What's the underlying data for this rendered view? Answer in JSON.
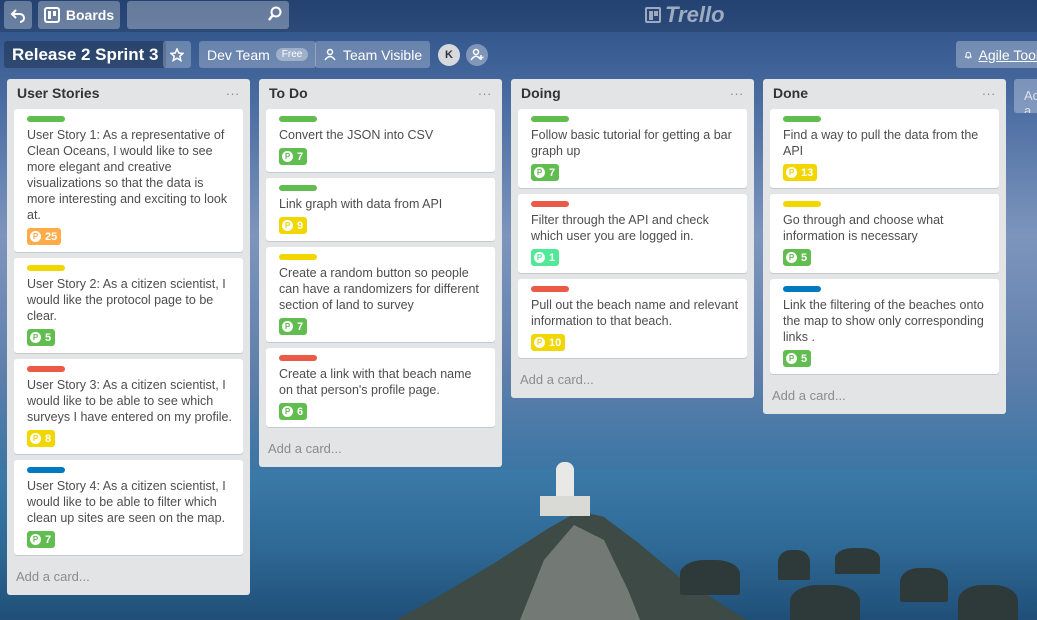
{
  "header": {
    "boards_label": "Boards",
    "search_placeholder": "",
    "logo_text": "Trello"
  },
  "board": {
    "title": "Release 2 Sprint 3",
    "team_label": "Dev Team",
    "team_badge": "Free",
    "visibility_label": "Team Visible",
    "avatar_initial": "K",
    "agile_label": "Agile Tools"
  },
  "colors": {
    "green": "#61bd4f",
    "yellow": "#f2d600",
    "red": "#eb5a46",
    "blue": "#0079bf",
    "orange": "#ffab4a",
    "teal": "#51e898"
  },
  "lists": [
    {
      "title": "User Stories",
      "menu": "...",
      "add_card": "Add a card...",
      "cards": [
        {
          "label": "green",
          "text": "User Story 1: As a representative of Clean Oceans, I would like to see more elegant and creative visualizations so that the data is more interesting and exciting to look at.",
          "points": "25",
          "badge": "orange"
        },
        {
          "label": "yellow",
          "text": "User Story 2: As a citizen scientist, I would like the protocol page to be clear.",
          "points": "5",
          "badge": "green"
        },
        {
          "label": "red",
          "text": "User Story 3: As a citizen scientist, I would like to be able to see which surveys I have entered on my profile.",
          "points": "8",
          "badge": "yellow"
        },
        {
          "label": "blue",
          "text": "User Story 4: As a citizen scientist, I would like to be able to filter which clean up sites are seen on the map.",
          "points": "7",
          "badge": "green"
        }
      ]
    },
    {
      "title": "To Do",
      "menu": "...",
      "add_card": "Add a card...",
      "cards": [
        {
          "label": "green",
          "text": "Convert the JSON into CSV",
          "points": "7",
          "badge": "green"
        },
        {
          "label": "green",
          "text": "Link graph with data from API",
          "points": "9",
          "badge": "yellow"
        },
        {
          "label": "yellow",
          "text": "Create a random button so people can have a randomizers for different section of land to survey",
          "points": "7",
          "badge": "green"
        },
        {
          "label": "red",
          "text": "Create a link with that beach name on that person's profile page.",
          "points": "6",
          "badge": "green"
        }
      ]
    },
    {
      "title": "Doing",
      "menu": "...",
      "add_card": "Add a card...",
      "cards": [
        {
          "label": "green",
          "text": "Follow basic tutorial for getting a bar graph up",
          "points": "7",
          "badge": "green"
        },
        {
          "label": "red",
          "text": "Filter through the API and check which user you are logged in.",
          "points": "1",
          "badge": "teal"
        },
        {
          "label": "red",
          "text": "Pull out the beach name and relevant information to that beach.",
          "points": "10",
          "badge": "yellow"
        }
      ]
    },
    {
      "title": "Done",
      "menu": "...",
      "add_card": "Add a card...",
      "cards": [
        {
          "label": "green",
          "text": "Find a way to pull the data from the API",
          "points": "13",
          "badge": "yellow"
        },
        {
          "label": "yellow",
          "text": "Go through and choose what information is necessary",
          "points": "5",
          "badge": "green"
        },
        {
          "label": "blue",
          "text": "Link the filtering of the beaches onto the map to show only corresponding links .",
          "points": "5",
          "badge": "green"
        }
      ]
    }
  ],
  "add_list_label": "Add a list..."
}
